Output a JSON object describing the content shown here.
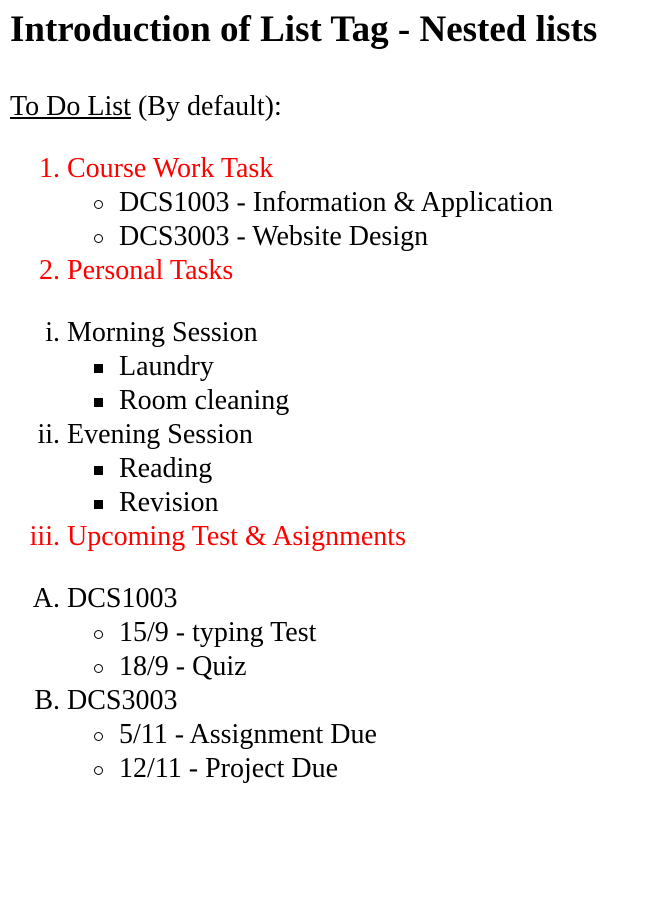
{
  "title": "Introduction of List Tag - Nested lists",
  "intro": {
    "underlined": "To Do List",
    "rest": " (By default):"
  },
  "colors": {
    "highlight": "#ff0000",
    "text": "#000000"
  },
  "list1": [
    {
      "marker": "1.",
      "label": "Course Work Task",
      "sub": [
        "DCS1003 - Information & Application",
        "DCS3003 - Website Design"
      ]
    },
    {
      "marker": "2.",
      "label": "Personal Tasks"
    }
  ],
  "list2": [
    {
      "marker": "i.",
      "label": "Morning Session",
      "sub": [
        "Laundry",
        "Room cleaning"
      ]
    },
    {
      "marker": "ii.",
      "label": "Evening Session",
      "sub": [
        "Reading",
        "Revision"
      ]
    },
    {
      "marker": "iii.",
      "label": "Upcoming Test & Asignments"
    }
  ],
  "list3": [
    {
      "marker": "A.",
      "label": "DCS1003",
      "sub": [
        "15/9 - typing Test",
        "18/9 - Quiz"
      ]
    },
    {
      "marker": "B.",
      "label": "DCS3003",
      "sub": [
        "5/11 - Assignment Due",
        "12/11 - Project Due"
      ]
    }
  ]
}
